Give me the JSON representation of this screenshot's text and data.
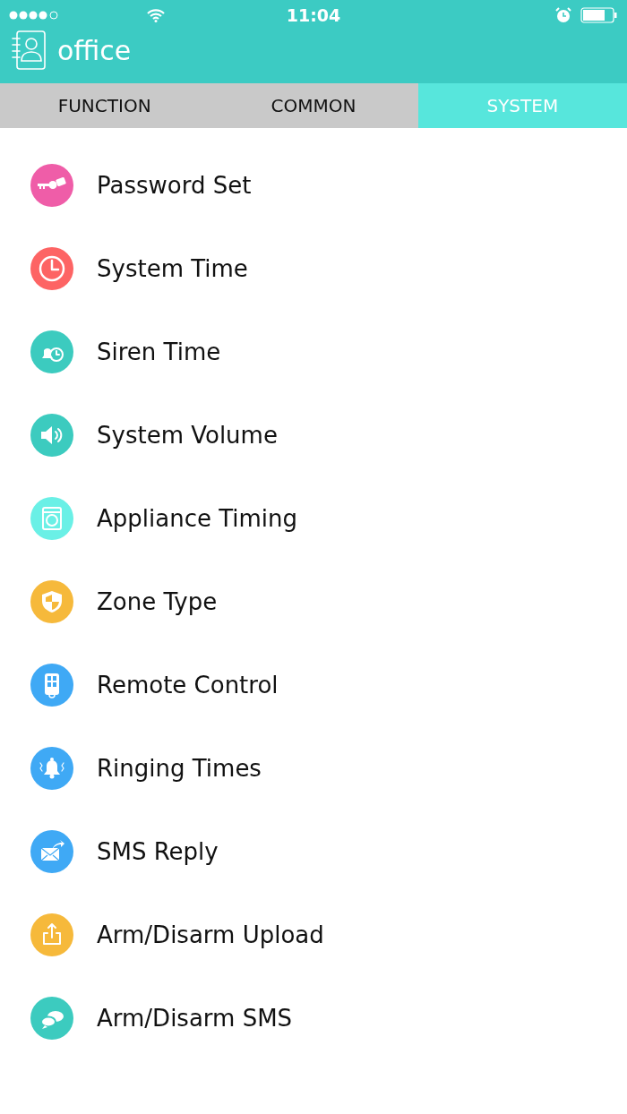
{
  "status_bar": {
    "time": "11:04"
  },
  "header": {
    "title": "office"
  },
  "tabs": [
    {
      "label": "FUNCTION",
      "selected": false
    },
    {
      "label": "COMMON",
      "selected": false
    },
    {
      "label": "SYSTEM",
      "selected": true
    }
  ],
  "menu": [
    {
      "label": "Password Set",
      "color": "#ef5da8"
    },
    {
      "label": "System Time",
      "color": "#fd6464"
    },
    {
      "label": "Siren Time",
      "color": "#3ccbbf"
    },
    {
      "label": "System Volume",
      "color": "#3ccbbf"
    },
    {
      "label": "Appliance Timing",
      "color": "#6af0e6"
    },
    {
      "label": "Zone Type",
      "color": "#f6b93b"
    },
    {
      "label": "Remote Control",
      "color": "#3fa9f5"
    },
    {
      "label": "Ringing Times",
      "color": "#3fa9f5"
    },
    {
      "label": "SMS Reply",
      "color": "#3fa9f5"
    },
    {
      "label": "Arm/Disarm Upload",
      "color": "#f6b93b"
    },
    {
      "label": "Arm/Disarm SMS",
      "color": "#3ccbbf"
    }
  ]
}
